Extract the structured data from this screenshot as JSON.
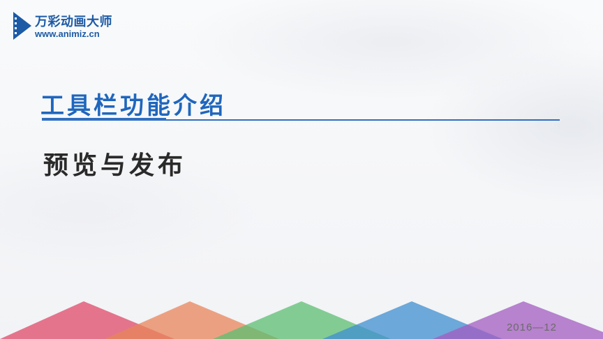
{
  "brand": {
    "name": "万彩动画大师",
    "url": "www.animiz.cn",
    "icon": "play-film-icon",
    "color": "#1c5aa6"
  },
  "slide": {
    "title": "工具栏功能介绍",
    "subtitle": "预览与发布",
    "date": "2016—12",
    "title_color": "#1f66bd"
  },
  "decoration": {
    "triangle_colors": [
      "#e0506e",
      "#e8865a",
      "#5cbf72",
      "#3f8fd0",
      "#a35cc0"
    ]
  }
}
